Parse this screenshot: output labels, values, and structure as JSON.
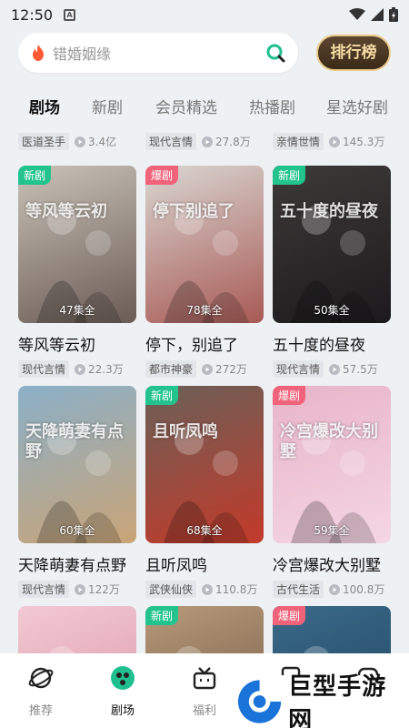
{
  "status": {
    "time": "12:50"
  },
  "search": {
    "placeholder": "错婚姻缘"
  },
  "rank_button": "排行榜",
  "tabs": [
    "剧场",
    "新剧",
    "会员精选",
    "热播剧",
    "星选好剧"
  ],
  "prev_row": [
    {
      "tag": "医道圣手",
      "views": "3.4亿"
    },
    {
      "tag": "现代言情",
      "views": "27.8万"
    },
    {
      "tag": "亲情世情",
      "views": "145.3万"
    }
  ],
  "cards": [
    {
      "badge": "新剧",
      "badge_type": "new",
      "episodes": "47集全",
      "title": "等风等云初",
      "tag": "现代言情",
      "views": "22.3万",
      "colors": [
        "#c9c2b8",
        "#6b5c55"
      ],
      "poster_text": "等风等云初"
    },
    {
      "badge": "爆剧",
      "badge_type": "hot",
      "episodes": "78集全",
      "title": "停下，别追了",
      "tag": "都市神豪",
      "views": "272万",
      "colors": [
        "#d9d6d2",
        "#a85a55"
      ],
      "poster_text": "停下别追了"
    },
    {
      "badge": "新剧",
      "badge_type": "new",
      "episodes": "50集全",
      "title": "五十度的昼夜",
      "tag": "现代言情",
      "views": "57.5万",
      "colors": [
        "#3e3a3a",
        "#1c1a1c"
      ],
      "poster_text": "五十度的昼夜"
    },
    {
      "badge": "",
      "badge_type": "",
      "episodes": "60集全",
      "title": "天降萌妻有点野",
      "tag": "现代言情",
      "views": "122万",
      "colors": [
        "#8bb0c8",
        "#c9a477"
      ],
      "poster_text": "天降萌妻有点野"
    },
    {
      "badge": "新剧",
      "badge_type": "new",
      "episodes": "68集全",
      "title": "且听凤鸣",
      "tag": "武侠仙侠",
      "views": "110.8万",
      "colors": [
        "#6a6058",
        "#c43a2a"
      ],
      "poster_text": "且听凤鸣"
    },
    {
      "badge": "爆剧",
      "badge_type": "hot",
      "episodes": "59集全",
      "title": "冷宫爆改大别墅",
      "tag": "古代生活",
      "views": "100.8万",
      "colors": [
        "#e8b4c8",
        "#f4d6e4"
      ],
      "poster_text": "冷宫爆改大别墅"
    },
    {
      "badge": "",
      "badge_type": "",
      "episodes": "",
      "title": "",
      "tag": "",
      "views": "",
      "colors": [
        "#f2c9d4",
        "#d88fa2"
      ],
      "poster_text": ""
    },
    {
      "badge": "新剧",
      "badge_type": "new",
      "episodes": "",
      "title": "",
      "tag": "",
      "views": "",
      "colors": [
        "#b89a7a",
        "#6a5240"
      ],
      "poster_text": ""
    },
    {
      "badge": "爆剧",
      "badge_type": "hot",
      "episodes": "",
      "title": "",
      "tag": "",
      "views": "",
      "colors": [
        "#3a6a8a",
        "#1f3f57"
      ],
      "poster_text": ""
    }
  ],
  "nav": [
    {
      "label": "推荐",
      "icon": "planet-icon"
    },
    {
      "label": "剧场",
      "icon": "theater-icon"
    },
    {
      "label": "福利",
      "icon": "gift-icon"
    },
    {
      "label": "",
      "icon": "history-icon"
    },
    {
      "label": "",
      "icon": "profile-icon"
    }
  ],
  "watermark": {
    "text": "巨型手游网"
  }
}
